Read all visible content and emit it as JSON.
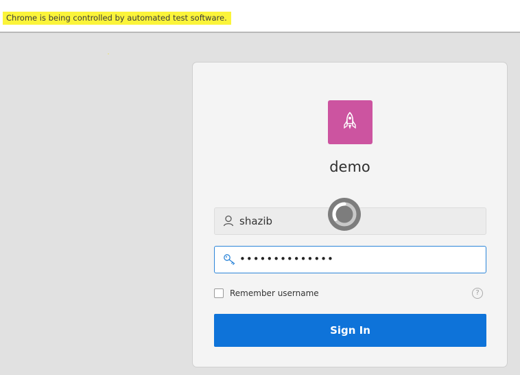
{
  "infobar": {
    "message": "Chrome is being controlled by automated test software."
  },
  "login": {
    "app_name": "demo",
    "username": {
      "value": "shazib",
      "icon": "user-icon"
    },
    "password": {
      "value": "••••••••••••••",
      "icon": "key-icon"
    },
    "remember_label": "Remember username",
    "help_glyph": "?",
    "signin_label": "Sign In",
    "logo_icon": "rocket-icon"
  },
  "colors": {
    "logo_bg": "#cc54a0",
    "primary_button": "#0e73d9",
    "focus_border": "#2a84d8",
    "infobar_highlight": "#fbf43a"
  }
}
